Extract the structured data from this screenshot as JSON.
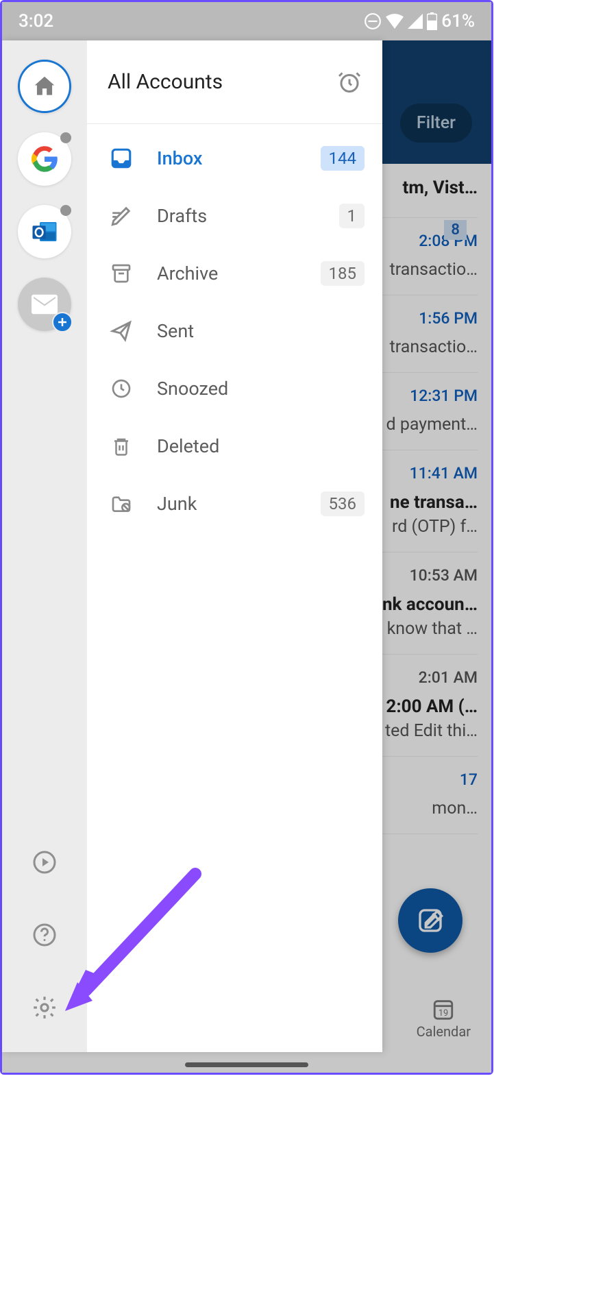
{
  "status_bar": {
    "time": "3:02",
    "battery": "61%"
  },
  "drawer": {
    "title": "All Accounts",
    "folders": [
      {
        "label": "Inbox",
        "count": "144",
        "active": true
      },
      {
        "label": "Drafts",
        "count": "1",
        "active": false
      },
      {
        "label": "Archive",
        "count": "185",
        "active": false
      },
      {
        "label": "Sent",
        "count": "",
        "active": false
      },
      {
        "label": "Snoozed",
        "count": "",
        "active": false
      },
      {
        "label": "Deleted",
        "count": "",
        "active": false
      },
      {
        "label": "Junk",
        "count": "536",
        "active": false
      }
    ]
  },
  "background": {
    "filter_label": "Filter",
    "unread_badge": "8",
    "items": [
      {
        "time": "",
        "l1": "tm, Vist…",
        "l2": ""
      },
      {
        "time": "2:08 PM",
        "l1": "",
        "l2": "transactio…"
      },
      {
        "time": "1:56 PM",
        "l1": "",
        "l2": "transactio…"
      },
      {
        "time": "12:31 PM",
        "l1": "",
        "l2": "d payment…"
      },
      {
        "time": "11:41 AM",
        "l1": "ne transa…",
        "l2": "rd (OTP) f…"
      },
      {
        "time": "10:53 AM",
        "l1": "nk accoun…",
        "l2": "know that …",
        "time_gray": true
      },
      {
        "time": "2:01 AM",
        "l1": "2:00 AM (…",
        "l2": "ted Edit thi…",
        "time_gray": true
      },
      {
        "time": "17",
        "l1": "",
        "l2": "mon…"
      }
    ],
    "calendar_label": "Calendar",
    "calendar_day": "19"
  }
}
